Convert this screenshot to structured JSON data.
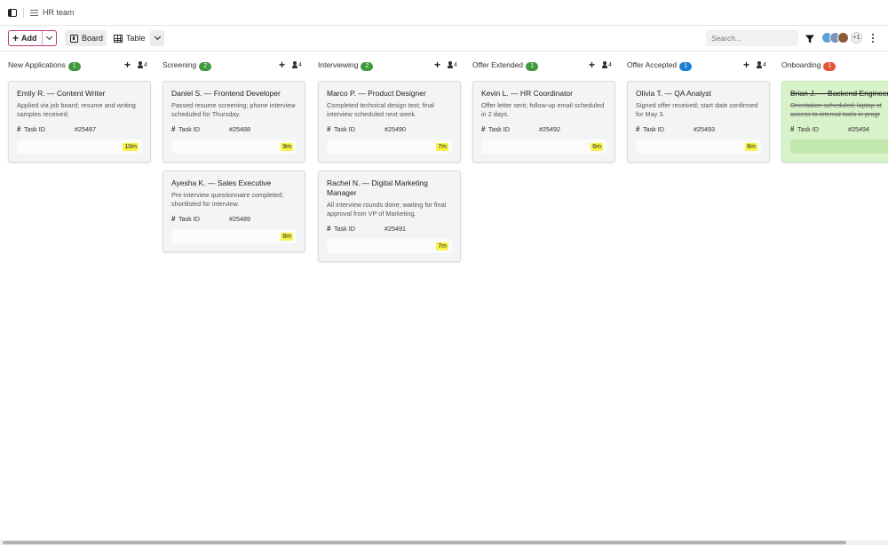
{
  "header": {
    "breadcrumb": "HR team"
  },
  "toolbar": {
    "add_label": "Add",
    "board_label": "Board",
    "table_label": "Table",
    "search_placeholder": "Search...",
    "avatars_more": "+1"
  },
  "colors": {
    "accent": "#c0367a",
    "badge_green": "#3f9a3b",
    "badge_blue": "#1c7fd1",
    "badge_red": "#e25535",
    "time_highlight": "#f6f34a",
    "done_card": "#d8f2c9"
  },
  "columns": [
    {
      "title": "New Applications",
      "count": "1",
      "badge_color": "#3f9a3b",
      "members": "4",
      "cards": [
        {
          "title": "Emily R. — Content Writer",
          "desc": "Applied via job board; resume and writing samples received.",
          "task_key": "Task ID",
          "task_id": "#25487",
          "time": "10m",
          "done": false
        }
      ]
    },
    {
      "title": "Screening",
      "count": "2",
      "badge_color": "#3f9a3b",
      "members": "4",
      "cards": [
        {
          "title": "Daniel S. — Frontend Developer",
          "desc": "Passed resume screening; phone interview scheduled for Thursday.",
          "task_key": "Task ID",
          "task_id": "#25488",
          "time": "9m",
          "done": false
        },
        {
          "title": "Ayesha K. — Sales Executive",
          "desc": "Pre-interview questionnaire completed; shortlisted for interview.",
          "task_key": "Task ID",
          "task_id": "#25489",
          "time": "8m",
          "done": false
        }
      ]
    },
    {
      "title": "Interviewing",
      "count": "2",
      "badge_color": "#3f9a3b",
      "members": "4",
      "cards": [
        {
          "title": "Marco P. — Product Designer",
          "desc": "Completed technical design test; final interview scheduled next week.",
          "task_key": "Task ID",
          "task_id": "#25490",
          "time": "7m",
          "done": false
        },
        {
          "title": "Rachel N. — Digital Marketing Manager",
          "desc": "All interview rounds done; waiting for final approval from VP of Marketing.",
          "task_key": "Task ID",
          "task_id": "#25491",
          "time": "7m",
          "done": false
        }
      ]
    },
    {
      "title": "Offer Extended",
      "count": "1",
      "badge_color": "#3f9a3b",
      "members": "4",
      "cards": [
        {
          "title": "Kevin L. — HR Coordinator",
          "desc": "Offer letter sent; follow-up email scheduled in 2 days.",
          "task_key": "Task ID",
          "task_id": "#25492",
          "time": "6m",
          "done": false
        }
      ]
    },
    {
      "title": "Offer Accepted",
      "count": "1",
      "badge_color": "#1c7fd1",
      "members": "4",
      "cards": [
        {
          "title": "Olivia T. — QA Analyst",
          "desc": "Signed offer received; start date confirmed for May 3.",
          "task_key": "Task ID",
          "task_id": "#25493",
          "time": "6m",
          "done": false
        }
      ]
    },
    {
      "title": "Onboarding",
      "count": "1",
      "badge_color": "#e25535",
      "members": "",
      "cards": [
        {
          "title": "Brian J. — Backend Engineer",
          "desc": "Orientation scheduled; laptop st... access to internal tools in progr...",
          "desc_lines": [
            "Orientation scheduled; laptop st",
            "access to internal tools in progr"
          ],
          "task_key": "Task ID",
          "task_id": "#25494",
          "time": "",
          "done": true
        }
      ]
    }
  ]
}
